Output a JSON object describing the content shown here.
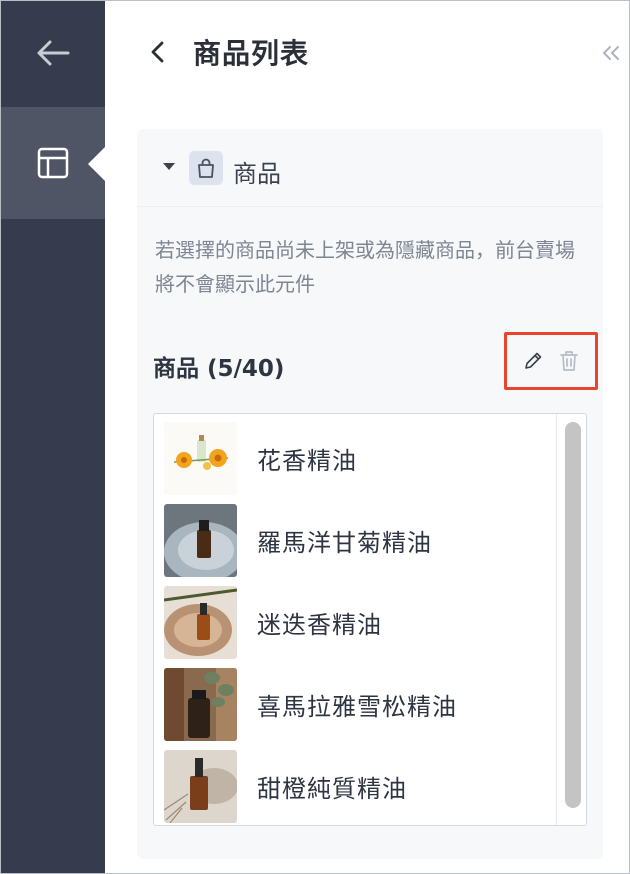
{
  "header": {
    "title": "商品列表"
  },
  "section": {
    "label": "商品",
    "hint": "若選擇的商品尚未上架或為隱藏商品，前台賣場將不會顯示此元件"
  },
  "product_list": {
    "title": "商品 (5/40)",
    "items": [
      {
        "name": "花香精油",
        "thumb": "calendula-flowers-bottle"
      },
      {
        "name": "羅馬洋甘菊精油",
        "thumb": "dark-bottle-on-plate"
      },
      {
        "name": "迷迭香精油",
        "thumb": "bottle-on-wood-slice"
      },
      {
        "name": "喜馬拉雅雪松精油",
        "thumb": "bottle-with-leaves"
      },
      {
        "name": "甜橙純質精油",
        "thumb": "dropper-bottle-dried-flowers"
      }
    ]
  },
  "icons": {
    "nav_back": "arrow-left-icon",
    "nav_layout": "layout-icon",
    "header_back": "chevron-left-icon",
    "collapse": "double-chevron-left-icon",
    "section_toggle": "caret-down-icon",
    "section_icon": "shopping-bag-icon",
    "edit": "pencil-icon",
    "delete": "trash-icon"
  },
  "colors": {
    "rail": "#363c4d",
    "rail_active": "#4f5565",
    "highlight_border": "#e8452c",
    "panel_bg": "#f7f8f9"
  }
}
